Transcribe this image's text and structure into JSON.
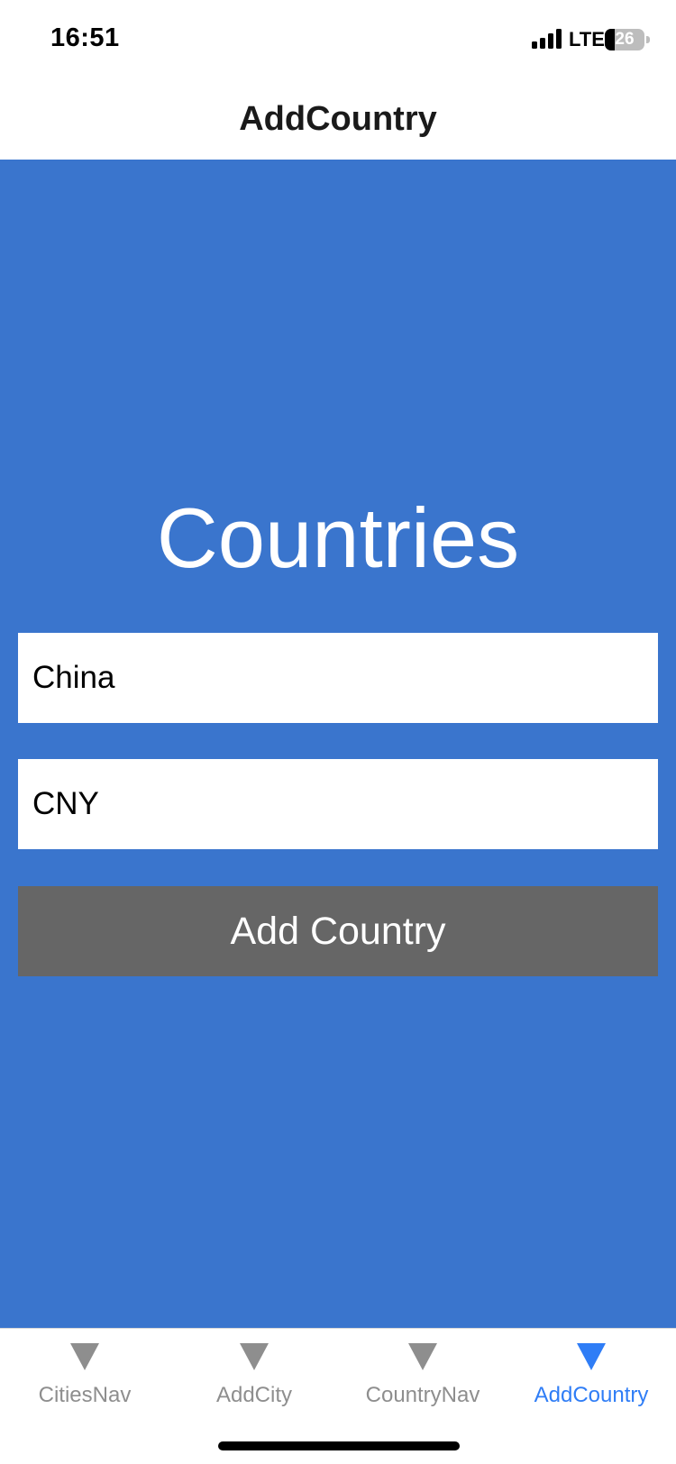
{
  "status_bar": {
    "time": "16:51",
    "network": "LTE",
    "battery_level": 26,
    "battery_text": "26"
  },
  "header": {
    "title": "AddCountry"
  },
  "main": {
    "background_color": "#3a75cd",
    "heading": "Countries",
    "country_field": {
      "value": "China"
    },
    "currency_field": {
      "value": "CNY"
    },
    "add_button_label": "Add Country"
  },
  "tab_bar": {
    "active_color": "#2f7df6",
    "inactive_color": "#8e8e8e",
    "tabs": [
      {
        "label": "CitiesNav",
        "icon": "triangle-down-icon",
        "active": false
      },
      {
        "label": "AddCity",
        "icon": "triangle-down-icon",
        "active": false
      },
      {
        "label": "CountryNav",
        "icon": "triangle-down-icon",
        "active": false
      },
      {
        "label": "AddCountry",
        "icon": "triangle-down-icon",
        "active": true
      }
    ]
  }
}
